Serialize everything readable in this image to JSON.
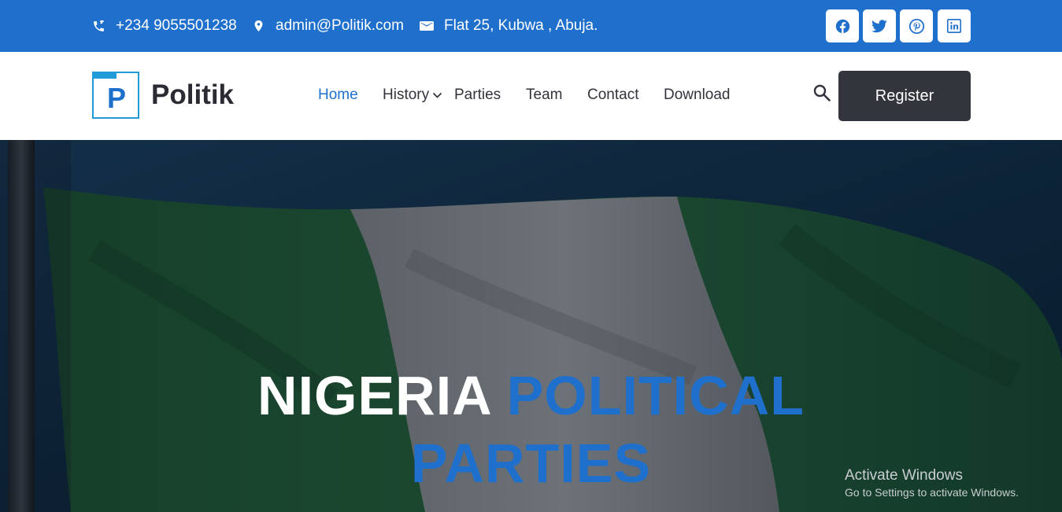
{
  "topbar": {
    "phone": "+234 9055501238",
    "email": "admin@Politik.com",
    "address": "Flat 25, Kubwa , Abuja.",
    "social": [
      "facebook-icon",
      "twitter-icon",
      "pinterest-icon",
      "linkedin-icon"
    ]
  },
  "brand": {
    "logo_letter": "P",
    "name": "Politik"
  },
  "nav": {
    "items": [
      {
        "label": "Home",
        "active": true
      },
      {
        "label": "History",
        "dropdown": true
      },
      {
        "label": "Parties"
      },
      {
        "label": "Team"
      },
      {
        "label": "Contact"
      },
      {
        "label": "Download"
      }
    ],
    "register_label": "Register"
  },
  "hero": {
    "line1_white": "NIGERIA",
    "line1_blue": "POLITICAL",
    "line2": "PARTIES"
  },
  "watermark": {
    "title": "Activate Windows",
    "subtitle": "Go to Settings to activate Windows."
  },
  "colors": {
    "primary": "#1f6fcc",
    "dark_button": "#33353d",
    "text": "#33333d"
  }
}
